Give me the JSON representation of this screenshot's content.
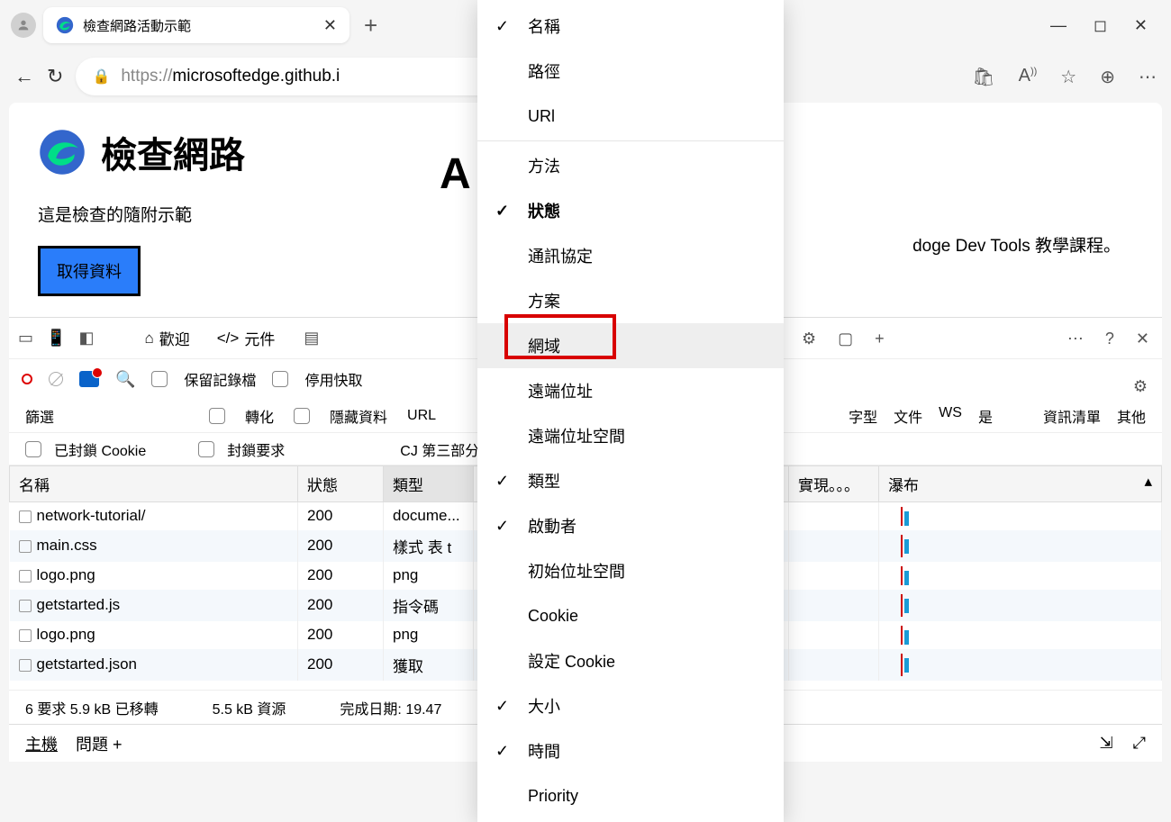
{
  "browser": {
    "tab_title": "檢查網路活動示範",
    "url_host": "microsoftedge.github.i",
    "url_prefix": "https://"
  },
  "page": {
    "h1": "檢查網路",
    "subtitle": "這是檢查的隨附示範",
    "teach_suffix": "doge Dev Tools 教學課程。",
    "btn_get": "取得資料",
    "big_a": "A"
  },
  "devtools": {
    "tabs": {
      "welcome": "歡迎",
      "elements": "元件"
    },
    "toolbar": {
      "preserve": "保留記錄檔",
      "disable_cache": "停用快取"
    },
    "filter": {
      "label": "篩選",
      "transform": "轉化",
      "hide": "隱藏資料",
      "url": "URL",
      "font": "字型",
      "doc": "文件",
      "ws": "WS",
      "is": "是",
      "manifest": "資訊清單",
      "other": "其他"
    },
    "extra": {
      "blocked": "已封鎖 Cookie",
      "blocked_req": "封鎖要求",
      "third": "CJ 第三部分)"
    },
    "columns": {
      "name": "名稱",
      "status": "狀態",
      "type": "類型",
      "fulfill": "實現。。。",
      "waterfall": "瀑布"
    },
    "rows": [
      {
        "name": "network-tutorial/",
        "status": "200",
        "type": "docume..."
      },
      {
        "name": "main.css",
        "status": "200",
        "type": "樣式 表  t"
      },
      {
        "name": "logo.png",
        "status": "200",
        "type": "png"
      },
      {
        "name": "getstarted.js",
        "status": "200",
        "type": "指令碼"
      },
      {
        "name": "logo.png",
        "status": "200",
        "type": "png"
      },
      {
        "name": "getstarted.json",
        "status": "200",
        "type": "獲取"
      }
    ],
    "status": {
      "req": "6 要求 5.9 kB 已移轉",
      "res": "5.5 kB 資源",
      "done": "完成日期: 19.47"
    },
    "bottom": {
      "host": "主機",
      "issues": "問題 +"
    }
  },
  "context_menu": [
    {
      "label": "名稱",
      "checked": true,
      "bold": false
    },
    {
      "label": "路徑",
      "checked": false,
      "bold": false
    },
    {
      "label": "URl",
      "checked": false,
      "bold": false
    },
    {
      "sep": true
    },
    {
      "label": "方法",
      "checked": false,
      "bold": false
    },
    {
      "label": "狀態",
      "checked": true,
      "bold": true
    },
    {
      "label": "通訊協定",
      "checked": false,
      "bold": false
    },
    {
      "label": "方案",
      "checked": false,
      "bold": false
    },
    {
      "label": "網域",
      "checked": false,
      "bold": false,
      "hover": true
    },
    {
      "label": "遠端位址",
      "checked": false,
      "bold": false
    },
    {
      "label": "遠端位址空間",
      "checked": false,
      "bold": false
    },
    {
      "label": "類型",
      "checked": true,
      "bold": false
    },
    {
      "label": "啟動者",
      "checked": true,
      "bold": false
    },
    {
      "label": "初始位址空間",
      "checked": false,
      "bold": false
    },
    {
      "label": "Cookie",
      "checked": false,
      "bold": false
    },
    {
      "label": "設定 Cookie",
      "checked": false,
      "bold": false
    },
    {
      "label": "大小",
      "checked": true,
      "bold": false
    },
    {
      "label": "時間",
      "checked": true,
      "bold": false
    },
    {
      "label": "Priority",
      "checked": false,
      "bold": false
    }
  ]
}
